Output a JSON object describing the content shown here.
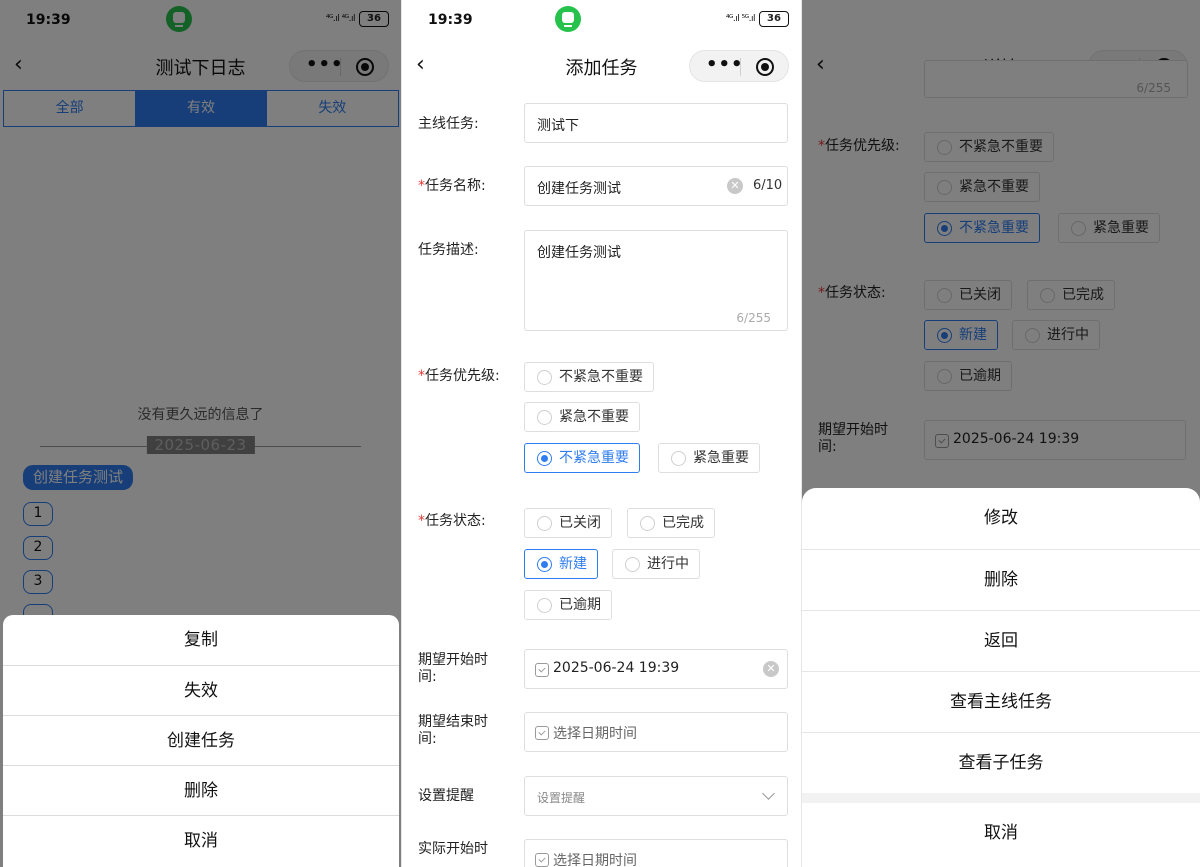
{
  "status": {
    "time": "19:39",
    "signal1": "⁴ᴳ.ıl ⁴ᴳ.ıl",
    "signal2": "⁴ᴳ.ıl ⁵ᴳ.ıl",
    "battery": "36"
  },
  "nav": {
    "back": "‹",
    "dots": "•••"
  },
  "panel1": {
    "title": "测试下日志",
    "tabs": [
      "全部",
      "有效",
      "失效"
    ],
    "no_more": "没有更久远的信息了",
    "date": "2025-06-23",
    "task_chip": "创建任务测试",
    "numbers": [
      "1",
      "2",
      "3"
    ],
    "sheet": [
      "复制",
      "失效",
      "创建任务",
      "删除",
      "取消"
    ]
  },
  "panel2": {
    "title": "添加任务",
    "main_task": {
      "label": "主线任务:",
      "value": "测试下"
    },
    "task_name": {
      "label": "任务名称:",
      "value": "创建任务测试",
      "counter": "6/10"
    },
    "task_desc": {
      "label": "任务描述:",
      "value": "创建任务测试",
      "counter": "6/255"
    },
    "priority": {
      "label": "任务优先级:",
      "options": [
        "不紧急不重要",
        "紧急不重要",
        "不紧急重要",
        "紧急重要"
      ],
      "selected": "不紧急重要"
    },
    "status": {
      "label": "任务状态:",
      "options": [
        "已关闭",
        "已完成",
        "新建",
        "进行中",
        "已逾期"
      ],
      "selected": "新建"
    },
    "expect_start": {
      "label": "期望开始时\n间:",
      "value": "2025-06-24 19:39"
    },
    "expect_end": {
      "label": "期望结束时\n间:",
      "placeholder": "选择日期时间"
    },
    "reminder": {
      "label": "设置提醒",
      "placeholder": "设置提醒"
    },
    "actual_start": {
      "label": "实际开始时",
      "placeholder": "选择日期时间"
    },
    "required_mark": "*"
  },
  "panel3": {
    "title": "详情",
    "desc_counter": "6/255",
    "priority": {
      "label": "任务优先级:",
      "options": [
        "不紧急不重要",
        "紧急不重要",
        "不紧急重要",
        "紧急重要"
      ],
      "selected": "不紧急重要"
    },
    "status": {
      "label": "任务状态:",
      "options": [
        "已关闭",
        "已完成",
        "新建",
        "进行中",
        "已逾期"
      ],
      "selected": "新建"
    },
    "expect_start": {
      "label": "期望开始时\n间:",
      "value": "2025-06-24 19:39"
    },
    "sheet": [
      "修改",
      "删除",
      "返回",
      "查看主线任务",
      "查看子任务",
      "取消"
    ]
  },
  "colors": {
    "accent": "#2f7df0",
    "required": "#e53935",
    "app_icon": "#27c24c"
  }
}
